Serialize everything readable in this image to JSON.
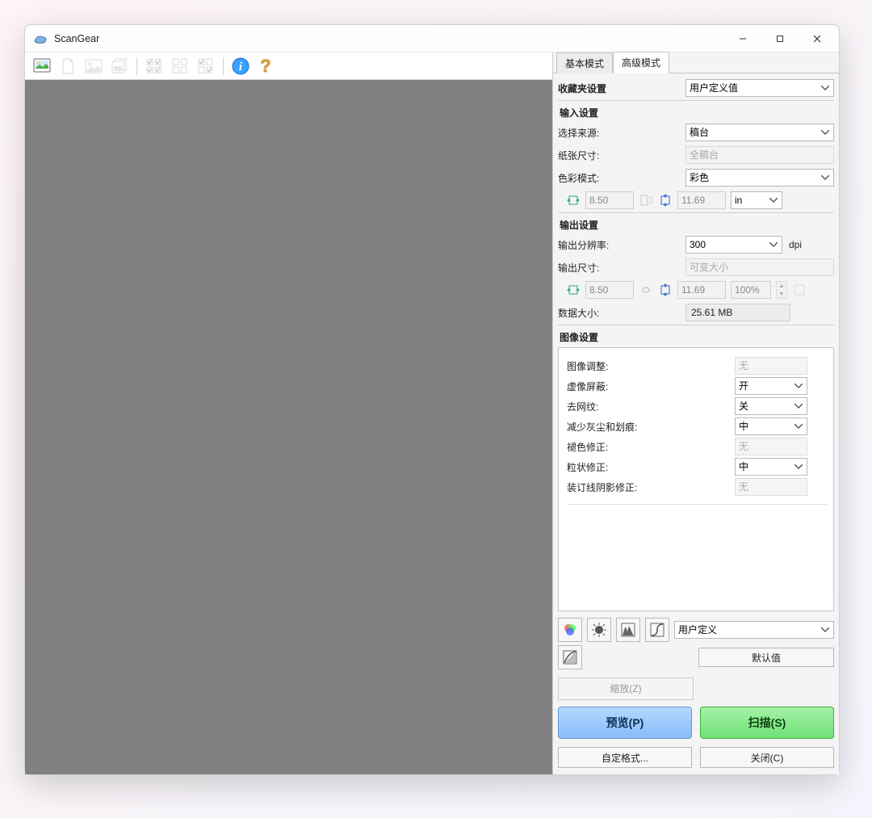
{
  "window": {
    "title": "ScanGear"
  },
  "toolbar": {
    "btn1": "thumbnail-image-icon",
    "btn2": "page-blank-icon",
    "btn3": "image-icon",
    "btn4": "multi-page-icon",
    "btn5": "checkboxes-icon",
    "btn6": "grid-icon",
    "btn7": "grid-check-icon",
    "btn8": "info-icon",
    "btn9": "help-icon"
  },
  "tabs": {
    "basic": "基本模式",
    "advanced": "高级模式"
  },
  "favorites": {
    "label": "收藏夹设置",
    "value": "用户定义值"
  },
  "input": {
    "header": "输入设置",
    "source_label": "选择来源:",
    "source_value": "稿台",
    "paper_label": "纸张尺寸:",
    "paper_value": "全稿台",
    "color_label": "色彩模式:",
    "color_value": "彩色",
    "width": "8.50",
    "height": "11.69",
    "unit": "in"
  },
  "output": {
    "header": "输出设置",
    "res_label": "输出分辨率:",
    "res_value": "300",
    "res_unit": "dpi",
    "size_label": "输出尺寸:",
    "size_value": "可变大小",
    "width": "8.50",
    "height": "11.69",
    "scale": "100%",
    "data_label": "数据大小:",
    "data_value": "25.61 MB"
  },
  "image": {
    "header": "图像设置",
    "adjust_label": "图像调整:",
    "adjust_value": "无",
    "unsharp_label": "虚像屏蔽:",
    "unsharp_value": "开",
    "descreen_label": "去网纹:",
    "descreen_value": "关",
    "dust_label": "减少灰尘和划痕:",
    "dust_value": "中",
    "fading_label": "褪色修正:",
    "fading_value": "无",
    "grain_label": "粒状修正:",
    "grain_value": "中",
    "gutter_label": "装订线阴影修正:",
    "gutter_value": "无"
  },
  "coloradj": {
    "preset": "用户定义",
    "defaults": "默认值"
  },
  "actions": {
    "zoom": "缩放(Z)",
    "preview": "预览(P)",
    "scan": "扫描(S)",
    "custom": "自定格式...",
    "close": "关闭(C)"
  }
}
